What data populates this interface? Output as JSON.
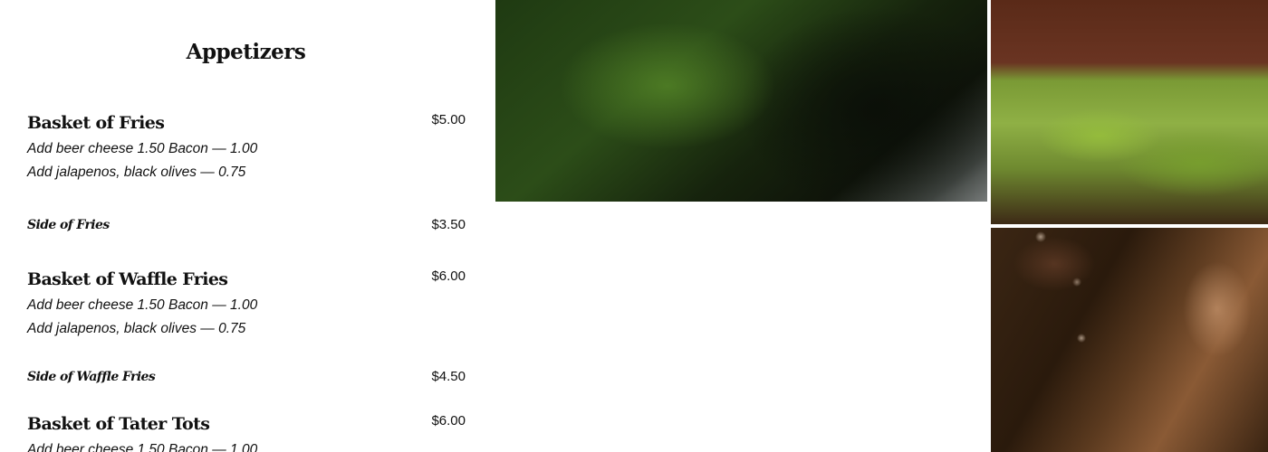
{
  "menu": {
    "section_title": "Appetizers",
    "items": [
      {
        "name": "Basket of Fries",
        "price": "$5.00",
        "desc": [
          "Add beer cheese 1.50 Bacon — 1.00",
          "Add jalapenos, black olives — 0.75"
        ]
      },
      {
        "name": "Side of Fries",
        "price": "$3.50"
      },
      {
        "name": "Basket of Waffle Fries",
        "price": "$6.00",
        "desc": [
          "Add beer cheese 1.50 Bacon — 1.00",
          "Add jalapenos, black olives — 0.75"
        ]
      },
      {
        "name": "Side of Waffle Fries",
        "price": "$4.50"
      },
      {
        "name": "Basket of Tater Tots",
        "price": "$6.00",
        "desc": [
          "Add beer cheese 1.50 Bacon — 1.00"
        ]
      }
    ]
  },
  "photos": {
    "top_center": "photo-greens",
    "top_right": "photo-salad",
    "bottom_right": "photo-dessert"
  }
}
